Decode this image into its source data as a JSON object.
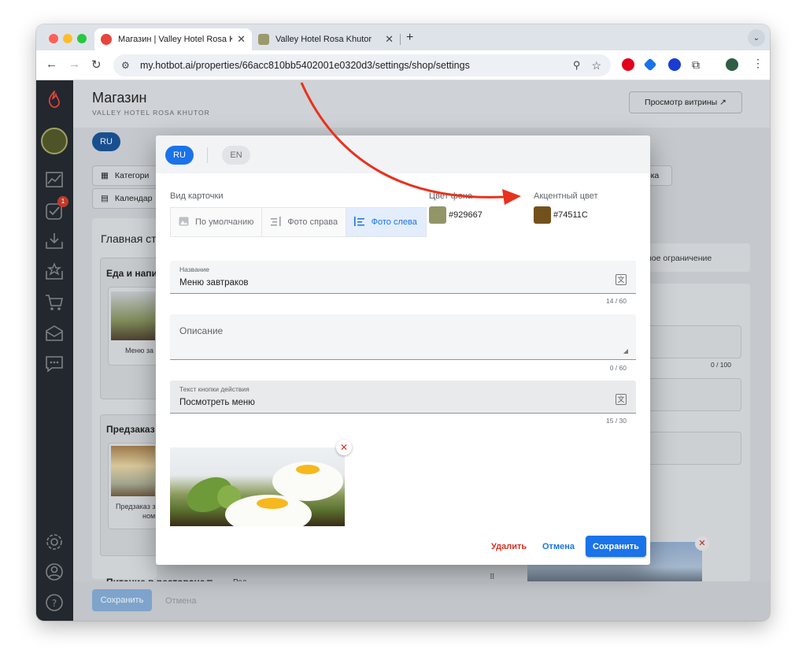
{
  "browser": {
    "tabs": [
      {
        "title": "Магазин | Valley Hotel Rosa Khutor",
        "active": true
      },
      {
        "title": "Valley Hotel Rosa Khutor",
        "active": false
      }
    ],
    "url": "my.hotbot.ai/properties/66acc810bb5402001e0320d3/settings/shop/settings"
  },
  "sidebar": {
    "badge_count": "1",
    "icons": [
      "flame-logo-icon",
      "user-avatar-icon",
      "analytics-icon",
      "tasks-icon",
      "inbox-icon",
      "reviews-icon",
      "shop-cart-icon",
      "mail-icon",
      "chat-icon",
      "settings-icon",
      "profile-icon",
      "help-icon"
    ]
  },
  "background": {
    "title": "Магазин",
    "subtitle": "VALLEY HOTEL ROSA KHUTOR",
    "preview_button": "Просмотр витрины ↗",
    "lang_ru": "RU",
    "chip_categories": "Категори",
    "chip_calendar": "Календар",
    "chip_right": "вка",
    "main_page_heading": "Главная ст",
    "section_food": "Еда и напит",
    "food_card_caption": "Меню за",
    "section_preorder": "Предзаказ",
    "preorder_card_caption_1": "Предзаказ з",
    "preorder_card_caption_2": "ном",
    "section_restaurant": "Питание в ресторане",
    "restaurant_extra": "Ред",
    "limit_text": "ное ограничение",
    "counter_right": "0 / 100",
    "save_button": "Сохранить",
    "cancel_button": "Отмена"
  },
  "dialog": {
    "lang_ru": "RU",
    "lang_en": "EN",
    "card_view_label": "Вид карточки",
    "card_views": [
      {
        "label": "По умолчанию",
        "icon": "image-icon",
        "selected": false
      },
      {
        "label": "Фото справа",
        "icon": "align-right-icon",
        "selected": false
      },
      {
        "label": "Фото слева",
        "icon": "align-left-icon",
        "selected": true
      }
    ],
    "bg_color_label": "Цвет фона",
    "bg_color_value": "#929667",
    "accent_color_label": "Акцентный цвет",
    "accent_color_value": "#74511C",
    "name_label": "Название",
    "name_value": "Меню завтраков",
    "name_counter": "14 / 60",
    "description_placeholder": "Описание",
    "description_counter": "0 / 60",
    "action_label": "Текст кнопки действия",
    "action_value": "Посмотреть меню",
    "action_counter": "15 / 30",
    "delete_button": "Удалить",
    "cancel_button": "Отмена",
    "save_button": "Сохранить"
  },
  "colors": {
    "primary": "#1a73e8",
    "danger": "#d93025",
    "annotation_arrow": "#e8321c"
  }
}
